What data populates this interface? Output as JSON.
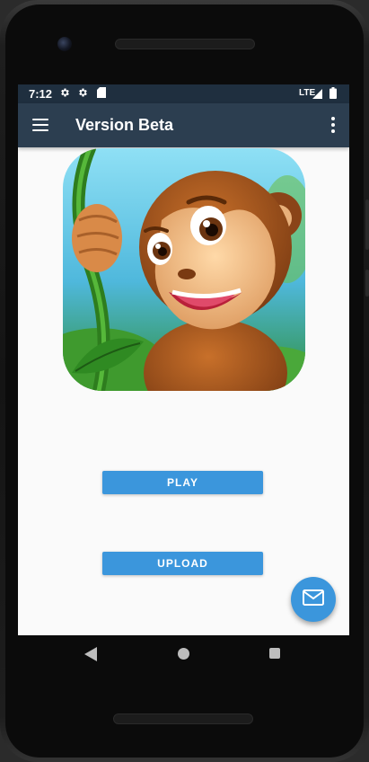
{
  "status_bar": {
    "time": "7:12",
    "icons": [
      "settings-icon",
      "settings-icon",
      "sd-card-icon"
    ],
    "network": "LTE",
    "signal": "signal-icon",
    "battery": "battery-icon"
  },
  "app_bar": {
    "title": "Version Beta",
    "menu_icon": "menu-icon",
    "overflow_icon": "more-vert-icon"
  },
  "hero_image": {
    "description_icon": "monkey-app-icon",
    "colors": {
      "sky": "#6cc6e8",
      "fur": "#a0521d",
      "face": "#f5c08a",
      "vine": "#2e7d1e"
    }
  },
  "buttons": {
    "play_label": "PLAY",
    "upload_label": "UPLOAD"
  },
  "fab": {
    "icon": "mail-icon"
  },
  "nav": {
    "back": "back-icon",
    "home": "home-icon",
    "recent": "recent-apps-icon"
  },
  "colors": {
    "status_bar": "#1f2f3f",
    "app_bar": "#2c3e50",
    "accent": "#3b96dc",
    "background": "#fafafa"
  }
}
